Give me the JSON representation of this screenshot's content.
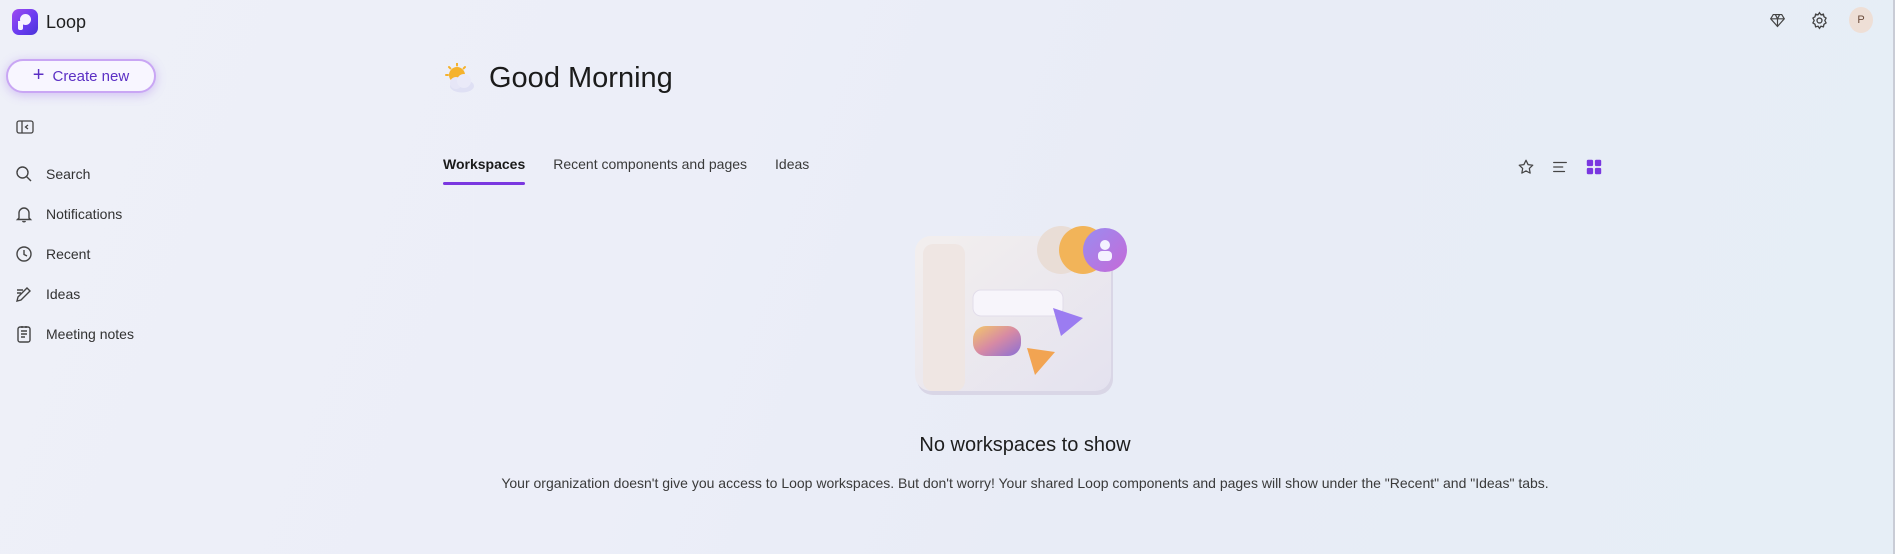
{
  "app": {
    "name": "Loop"
  },
  "top_actions": {
    "premium_icon": "diamond-icon",
    "settings_icon": "gear-icon",
    "avatar_initial": "P"
  },
  "sidebar": {
    "create_label": "Create new",
    "items": [
      {
        "label": "Search",
        "icon": "search-icon"
      },
      {
        "label": "Notifications",
        "icon": "bell-icon"
      },
      {
        "label": "Recent",
        "icon": "clock-icon"
      },
      {
        "label": "Ideas",
        "icon": "pen-icon"
      },
      {
        "label": "Meeting notes",
        "icon": "notes-icon"
      }
    ]
  },
  "main": {
    "greeting": "Good Morning",
    "tabs": [
      {
        "label": "Workspaces",
        "active": true
      },
      {
        "label": "Recent components and pages",
        "active": false
      },
      {
        "label": "Ideas",
        "active": false
      }
    ],
    "empty_state": {
      "title": "No workspaces to show",
      "description": "Your organization doesn't give you access to Loop workspaces. But don't worry! Your shared Loop components and pages will show under the \"Recent\" and \"Ideas\" tabs."
    }
  },
  "colors": {
    "accent": "#7a37e0",
    "background": "#eceef8"
  }
}
